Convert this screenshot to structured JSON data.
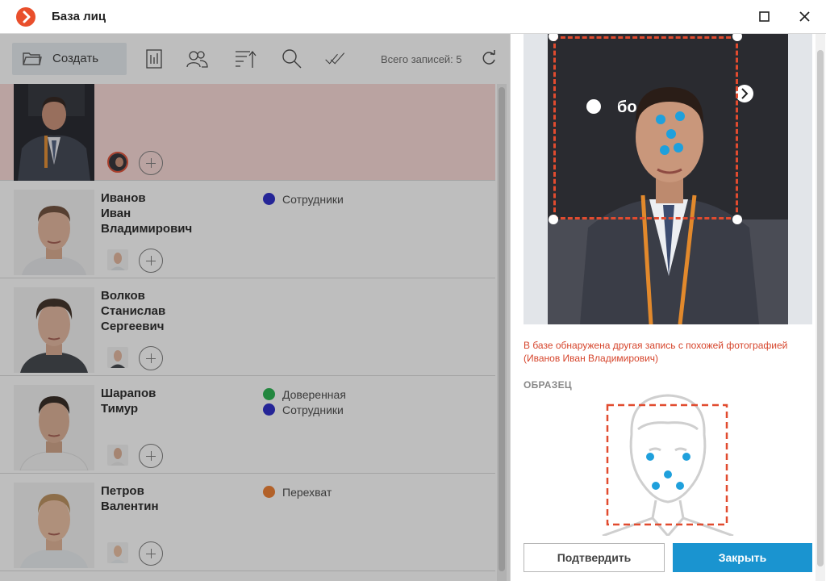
{
  "window": {
    "title": "База лиц"
  },
  "toolbar": {
    "create_label": "Создать",
    "total_label": "Всего записей: 5"
  },
  "rows": [
    {
      "lines": [],
      "groups": []
    },
    {
      "lines": [
        "Иванов",
        "Иван",
        "Владимирович"
      ],
      "groups": [
        {
          "name": "Сотрудники",
          "color": "#2424c8"
        }
      ]
    },
    {
      "lines": [
        "Волков",
        "Станислав",
        "Сергеевич"
      ],
      "groups": []
    },
    {
      "lines": [
        "Шарапов",
        "Тимур"
      ],
      "groups": [
        {
          "name": "Доверенная",
          "color": "#22b04a"
        },
        {
          "name": "Сотрудники",
          "color": "#2424c8"
        }
      ]
    },
    {
      "lines": [
        "Петров",
        "Валентин"
      ],
      "groups": [
        {
          "name": "Перехват",
          "color": "#ee7a2a"
        }
      ]
    }
  ],
  "detail": {
    "warning_line1": "В базе обнаружена другая запись с похожей фотографией",
    "warning_line2": "(Иванов  Иван  Владимирович)",
    "sample_label": "ОБРАЗЕЦ",
    "photo_caption": "бо",
    "confirm_label": "Подтвердить",
    "close_label": "Закрыть"
  },
  "colors": {
    "accent": "#1a94d0",
    "warning": "#d6452c",
    "selected_row": "#f9d8d6",
    "brand": "#e94f2c"
  }
}
